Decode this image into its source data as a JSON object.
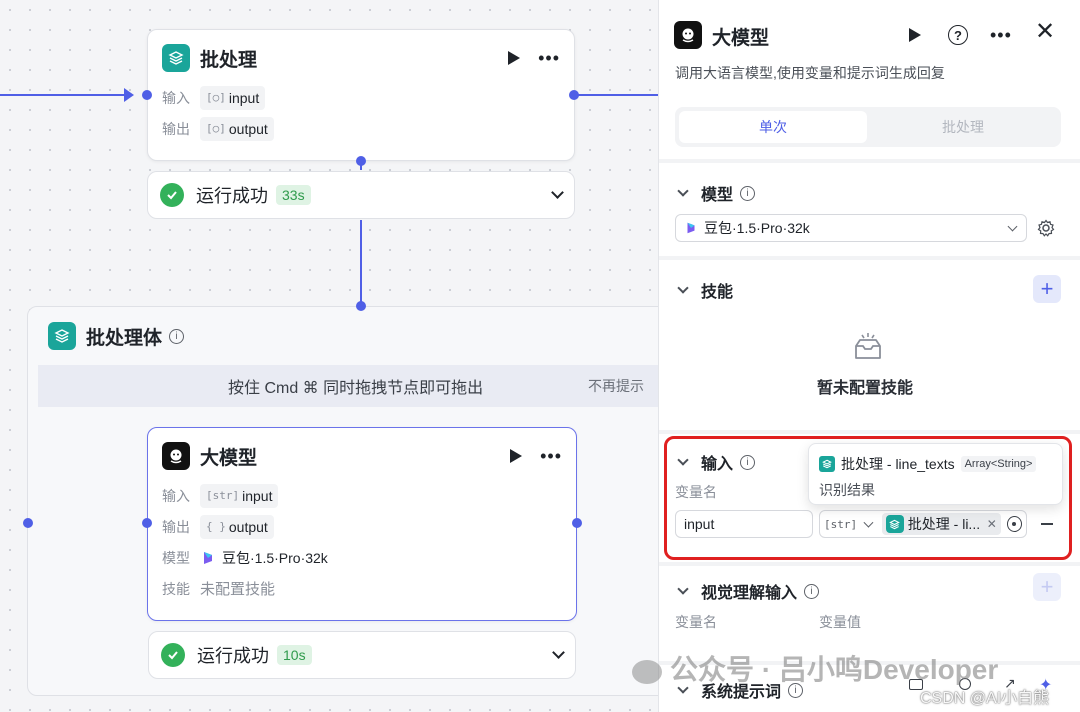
{
  "canvas": {
    "batch_node": {
      "title": "批处理",
      "input_label": "输入",
      "input_type": "[○]",
      "input_value": "input",
      "output_label": "输出",
      "output_type": "[○]",
      "output_value": "output",
      "status": "运行成功",
      "time": "33s"
    },
    "batch_body": {
      "title": "批处理体",
      "hint": "按住 Cmd ⌘ 同时拖拽节点即可拖出",
      "dismiss": "不再提示"
    },
    "llm_node": {
      "title": "大模型",
      "input_label": "输入",
      "input_type": "[str]",
      "input_value": "input",
      "output_label": "输出",
      "output_type": "{ }",
      "output_value": "output",
      "model_label": "模型",
      "model_value": "豆包·1.5·Pro·32k",
      "skill_label": "技能",
      "skill_value": "未配置技能",
      "status": "运行成功",
      "time": "10s"
    }
  },
  "panel": {
    "title": "大模型",
    "description": "调用大语言模型,使用变量和提示词生成回复",
    "tabs": [
      "单次",
      "批处理"
    ],
    "active_tab": "单次",
    "model_section": {
      "title": "模型",
      "selected": "豆包·1.5·Pro·32k"
    },
    "skill_section": {
      "title": "技能",
      "empty": "暂未配置技能"
    },
    "input_section": {
      "title": "输入",
      "col_name": "变量名",
      "var_name": "input",
      "var_type": "[str]",
      "ref_value": "批处理 - li...",
      "popup_source": "批处理 - line_texts",
      "popup_type": "Array<String>",
      "popup_desc": "识别结果"
    },
    "visual_section": {
      "title": "视觉理解输入",
      "col_name": "变量名",
      "col_value": "变量值"
    },
    "system_prompt": {
      "title": "系统提示词"
    }
  },
  "watermark": {
    "text": "公众号 · 吕小鸣Developer",
    "csdn": "CSDN @AI小白熊"
  },
  "colors": {
    "accent": "#4f5fe6",
    "success": "#33b15a",
    "highlight_border": "#e02020",
    "node_icon_green": "#1aa59a"
  }
}
